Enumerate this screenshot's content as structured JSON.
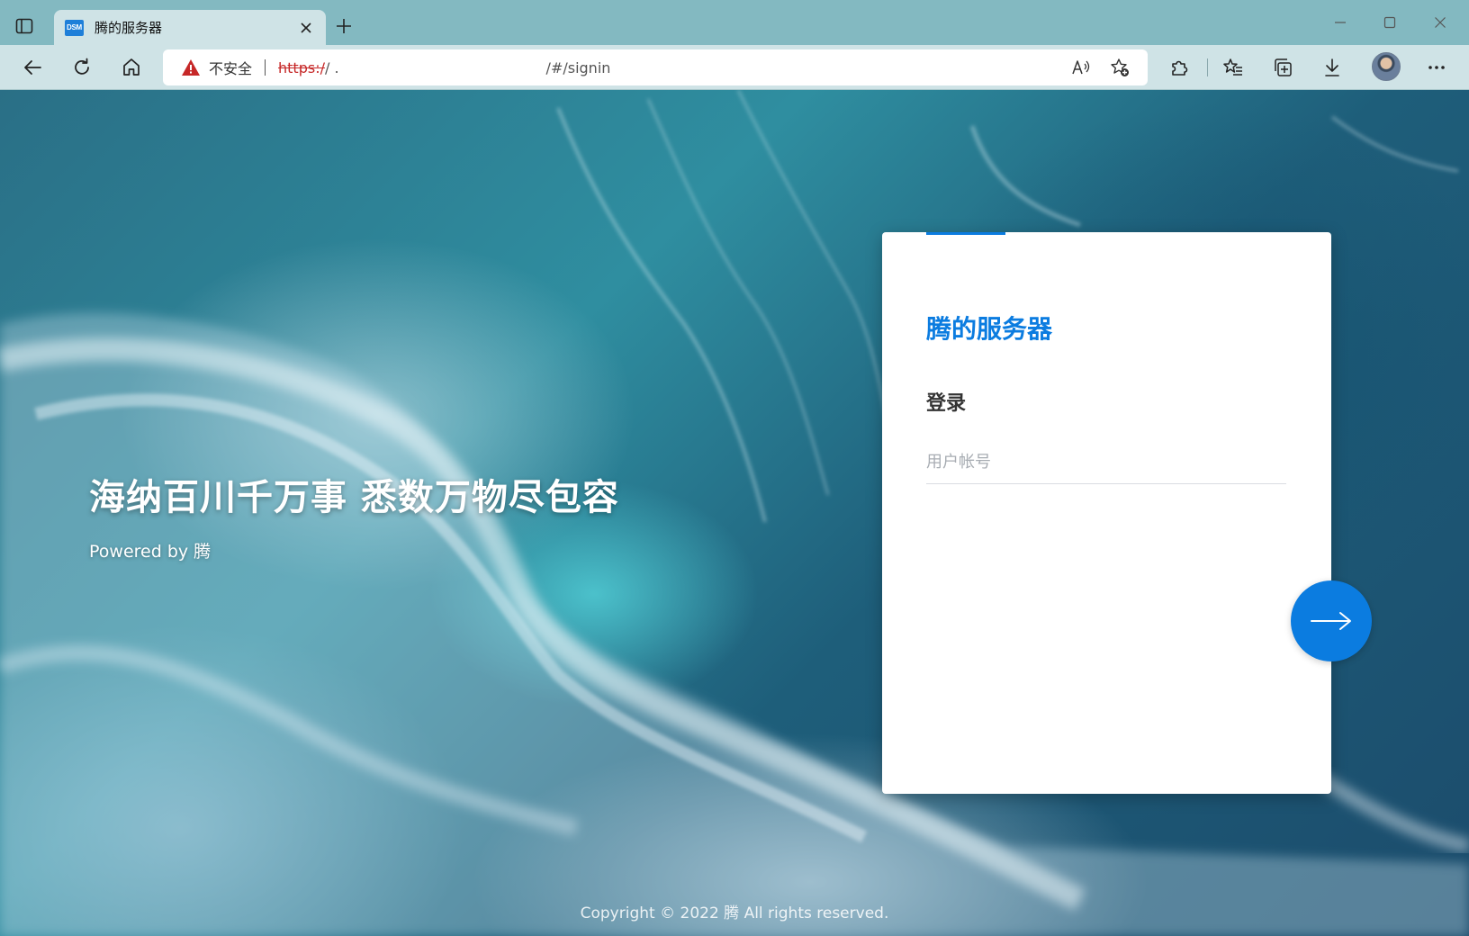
{
  "browser": {
    "tab": {
      "favicon_text": "DSM",
      "title": "腾的服务器"
    },
    "address_bar": {
      "security_label": "不安全",
      "url_scheme": "https:/",
      "url_prefix_visible": "/ .",
      "url_suffix_visible": "/#/signin"
    },
    "icons": {
      "tab_actions": "tab-actions-icon",
      "close_tab": "close-icon",
      "new_tab": "plus-icon",
      "minimize": "minimize-icon",
      "maximize": "maximize-icon",
      "close_window": "close-icon",
      "back": "back-arrow-icon",
      "refresh": "refresh-icon",
      "home": "home-icon",
      "warning": "warning-triangle-icon",
      "read_aloud": "read-aloud-icon",
      "add_favorite": "add-favorite-icon",
      "extensions": "puzzle-icon",
      "favorites": "favorites-icon",
      "collections": "collections-icon",
      "downloads": "download-icon",
      "profile": "avatar",
      "more": "more-icon"
    }
  },
  "page": {
    "hero": {
      "title": "海纳百川千万事 悉数万物尽包容",
      "subtitle": "Powered by 腾"
    },
    "login": {
      "brand": "腾的服务器",
      "heading": "登录",
      "username_placeholder": "用户帐号",
      "username_value": ""
    },
    "footer": {
      "copyright": "Copyright © 2022 腾 All rights reserved."
    }
  },
  "colors": {
    "accent": "#0b7ce0",
    "warning": "#c62828",
    "chrome": "#cfe3e6"
  }
}
